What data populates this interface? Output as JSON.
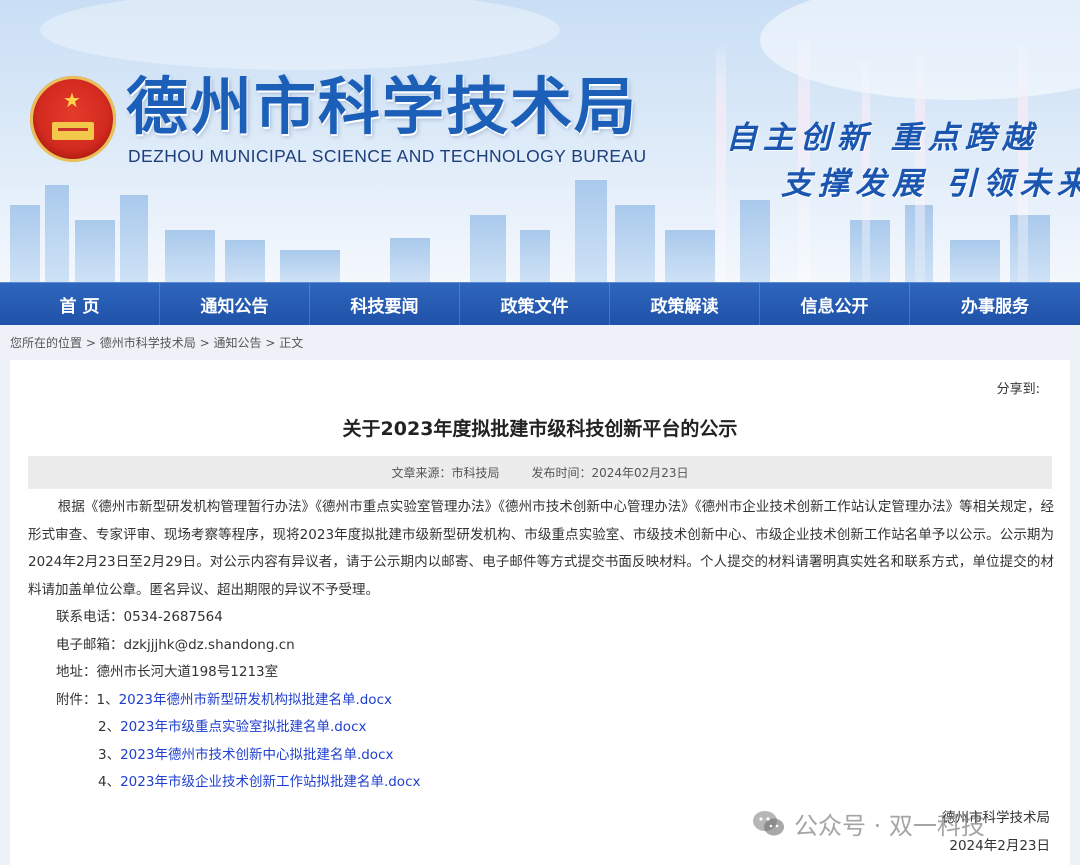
{
  "header": {
    "title_cn": "德州市科学技术局",
    "title_en": "DEZHOU MUNICIPAL SCIENCE AND TECHNOLOGY BUREAU",
    "slogan_line1": "自主创新 重点跨越",
    "slogan_line2": "支撑发展 引领未来",
    "emblem_icon": "national-emblem-icon",
    "brand_color": "#1b5fb8"
  },
  "nav": {
    "items": [
      {
        "label": "首 页"
      },
      {
        "label": "通知公告"
      },
      {
        "label": "科技要闻"
      },
      {
        "label": "政策文件"
      },
      {
        "label": "政策解读"
      },
      {
        "label": "信息公开"
      },
      {
        "label": "办事服务"
      }
    ],
    "bg_color": "#2659b0"
  },
  "breadcrumb": {
    "prefix": "您所在的位置",
    "items": [
      "德州市科学技术局",
      "通知公告",
      "正文"
    ],
    "separator": ">"
  },
  "article": {
    "share_label": "分享到:",
    "title": "关于2023年度拟批建市级科技创新平台的公示",
    "source": "文章来源：市科技局",
    "publish_time": "发布时间：2024年02月23日",
    "paragraph": "根据《德州市新型研发机构管理暂行办法》《德州市重点实验室管理办法》《德州市技术创新中心管理办法》《德州市企业技术创新工作站认定管理办法》等相关规定，经形式审查、专家评审、现场考察等程序，现将2023年度拟批建市级新型研发机构、市级重点实验室、市级技术创新中心、市级企业技术创新工作站名单予以公示。公示期为2024年2月23日至2月29日。对公示内容有异议者，请于公示期内以邮寄、电子邮件等方式提交书面反映材料。个人提交的材料请署明真实姓名和联系方式，单位提交的材料请加盖单位公章。匿名异议、超出期限的异议不予受理。",
    "phone": "联系电话：0534-2687564",
    "email": "电子邮箱：dzkjjjhk@dz.shandong.cn",
    "address": "地址：德州市长河大道198号1213室",
    "attachments_label": "附件：",
    "attachments": [
      {
        "num": "1、",
        "name": "2023年德州市新型研发机构拟批建名单.docx"
      },
      {
        "num": "2、",
        "name": "2023年市级重点实验室拟批建名单.docx"
      },
      {
        "num": "3、",
        "name": "2023年德州市技术创新中心拟批建名单.docx"
      },
      {
        "num": "4、",
        "name": "2023年市级企业技术创新工作站拟批建名单.docx"
      }
    ],
    "signature": "德州市科学技术局",
    "date": "2024年2月23日",
    "link_color": "#1f3fcf"
  },
  "watermark": {
    "text": "公众号 · 双一科技",
    "icon": "wechat-icon"
  }
}
